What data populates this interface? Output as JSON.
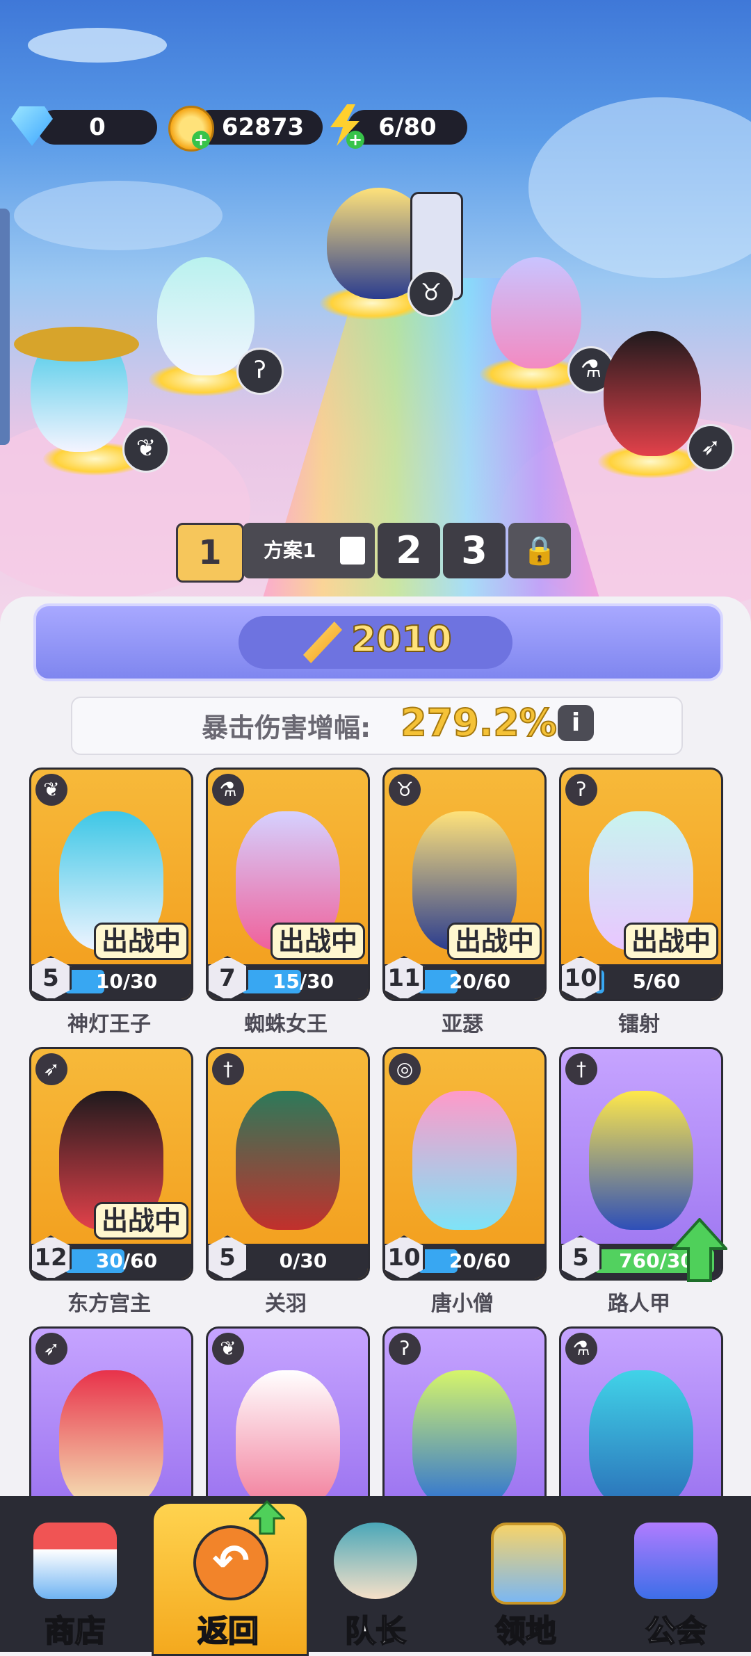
{
  "resources": {
    "gems": "0",
    "coins": "62873",
    "energy": "6/80"
  },
  "loadout": {
    "tab1": "1",
    "name": "方案1",
    "tab2": "2",
    "tab3": "3"
  },
  "stats": {
    "power": "2010",
    "crit_label": "暴击伤害增幅:",
    "crit_value": "279.2%"
  },
  "heroes": [
    {
      "name": "神灯王子",
      "level": "5",
      "shards": "10/30",
      "progress": 0.33,
      "deployed": "出战中"
    },
    {
      "name": "蜘蛛女王",
      "level": "7",
      "shards": "15/30",
      "progress": 0.5,
      "deployed": "出战中"
    },
    {
      "name": "亚瑟",
      "level": "11",
      "shards": "20/60",
      "progress": 0.33,
      "deployed": "出战中"
    },
    {
      "name": "镭射",
      "level": "10",
      "shards": "5/60",
      "progress": 0.08,
      "deployed": "出战中"
    },
    {
      "name": "东方宫主",
      "level": "12",
      "shards": "30/60",
      "progress": 0.5,
      "deployed": "出战中"
    },
    {
      "name": "关羽",
      "level": "5",
      "shards": "0/30",
      "progress": 0.0
    },
    {
      "name": "唐小僧",
      "level": "10",
      "shards": "20/60",
      "progress": 0.33
    },
    {
      "name": "路人甲",
      "level": "5",
      "shards": "760/30",
      "progress": 1.0
    }
  ],
  "nav": {
    "shop": "商店",
    "back": "返回",
    "captain": "队长",
    "territory": "领地",
    "guild": "公会"
  },
  "colors": {
    "gold_card": "#f5ab2a",
    "purple_card": "#b08cf8",
    "shard_bar": "#38a7f2",
    "shard_bar_full": "#52d15f",
    "nav_bg": "#2a2b34"
  }
}
